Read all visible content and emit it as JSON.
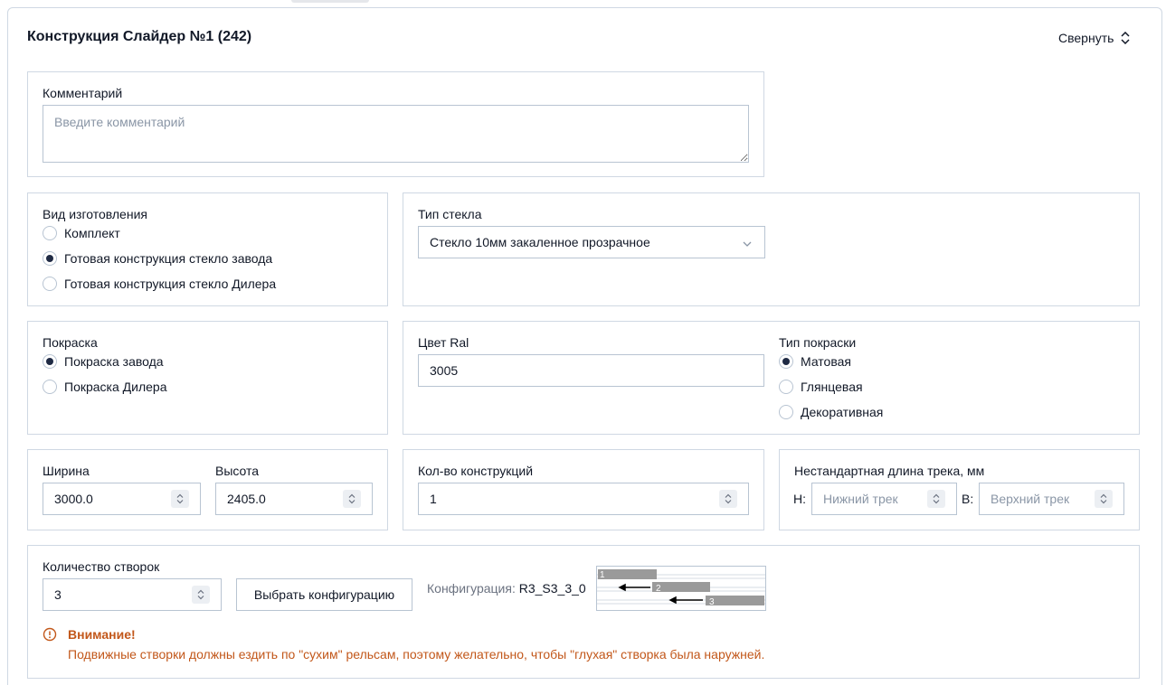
{
  "card": {
    "title": "Конструкция Слайдер №1 (242)",
    "collapse_label": "Свернуть"
  },
  "comment": {
    "label": "Комментарий",
    "placeholder": "Введите комментарий"
  },
  "manufacture": {
    "label": "Вид изготовления",
    "options": [
      {
        "label": "Комплект",
        "checked": false
      },
      {
        "label": "Готовая конструкция стекло завода",
        "checked": true
      },
      {
        "label": "Готовая конструкция стекло Дилера",
        "checked": false
      }
    ]
  },
  "glass": {
    "label": "Тип стекла",
    "value": "Стекло 10мм закаленное прозрачное"
  },
  "painting": {
    "label": "Покраска",
    "options": [
      {
        "label": "Покраска завода",
        "checked": true
      },
      {
        "label": "Покраска Дилера",
        "checked": false
      }
    ]
  },
  "ral": {
    "label": "Цвет Ral",
    "value": "3005"
  },
  "paint_type": {
    "label": "Тип покраски",
    "options": [
      {
        "label": "Матовая",
        "checked": true
      },
      {
        "label": "Глянцевая",
        "checked": false
      },
      {
        "label": "Декоративная",
        "checked": false
      }
    ]
  },
  "width": {
    "label": "Ширина",
    "value": "3000.0"
  },
  "height": {
    "label": "Высота",
    "value": "2405.0"
  },
  "quantity": {
    "label": "Кол-во конструкций",
    "value": "1"
  },
  "track": {
    "label": "Нестандартная длина трека, мм",
    "lower_prefix": "Н:",
    "lower_placeholder": "Нижний трек",
    "upper_prefix": "В:",
    "upper_placeholder": "Верхний трек"
  },
  "panels": {
    "label": "Количество створок",
    "value": "3",
    "choose_button": "Выбрать конфигурацию",
    "config_label": "Конфигурация:",
    "config_value": "R3_S3_3_0",
    "diagram_labels": [
      "1",
      "2",
      "3"
    ]
  },
  "warning": {
    "title": "Внимание!",
    "text": "Подвижные створки должны ездить по \"сухим\" рельсам, поэтому желательно, чтобы \"глухая\" створка была наружней."
  },
  "colors": {
    "accent": "#1f2a44",
    "border": "#cfd8e3",
    "warning": "#c2571a"
  }
}
